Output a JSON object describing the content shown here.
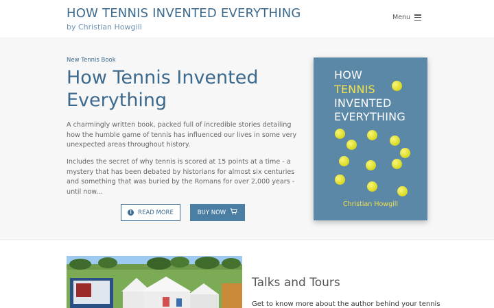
{
  "header": {
    "site_title": "HOW TENNIS INVENTED EVERYTHING",
    "tagline": "by Christian Howgill",
    "menu_label": "Menu"
  },
  "hero": {
    "eyebrow": "New Tennis Book",
    "title": "How Tennis Invented Everything",
    "paragraph1": "A charmingly written book, packed full of incredible stories detailing how the humble game of tennis has influenced our lives in some very unexpected areas throughout history.",
    "paragraph2": "Includes the secret of why tennis is scored at 15 points at a time - a mystery that has been debated by historians for almost six centuries and something that was buried by the Romans for over 2,000 years - until now...",
    "read_more_label": "READ MORE",
    "buy_now_label": "BUY NOW",
    "read_more_icon": "info-icon",
    "buy_now_icon": "cart-icon"
  },
  "cover": {
    "line1": "HOW",
    "line2": "TENNIS",
    "line3": "INVENTED",
    "line4": "EVERYTHING",
    "author": "Christian Howgill",
    "background_color": "#5c88a8",
    "highlight_color": "#f2e24a"
  },
  "talks": {
    "title": "Talks and Tours",
    "intro": "Get to know more about the author behind your tennis"
  },
  "colors": {
    "accent": "#3c6a8e",
    "button_fill": "#4a7ea3",
    "hero_background": "#f7f7f7"
  }
}
